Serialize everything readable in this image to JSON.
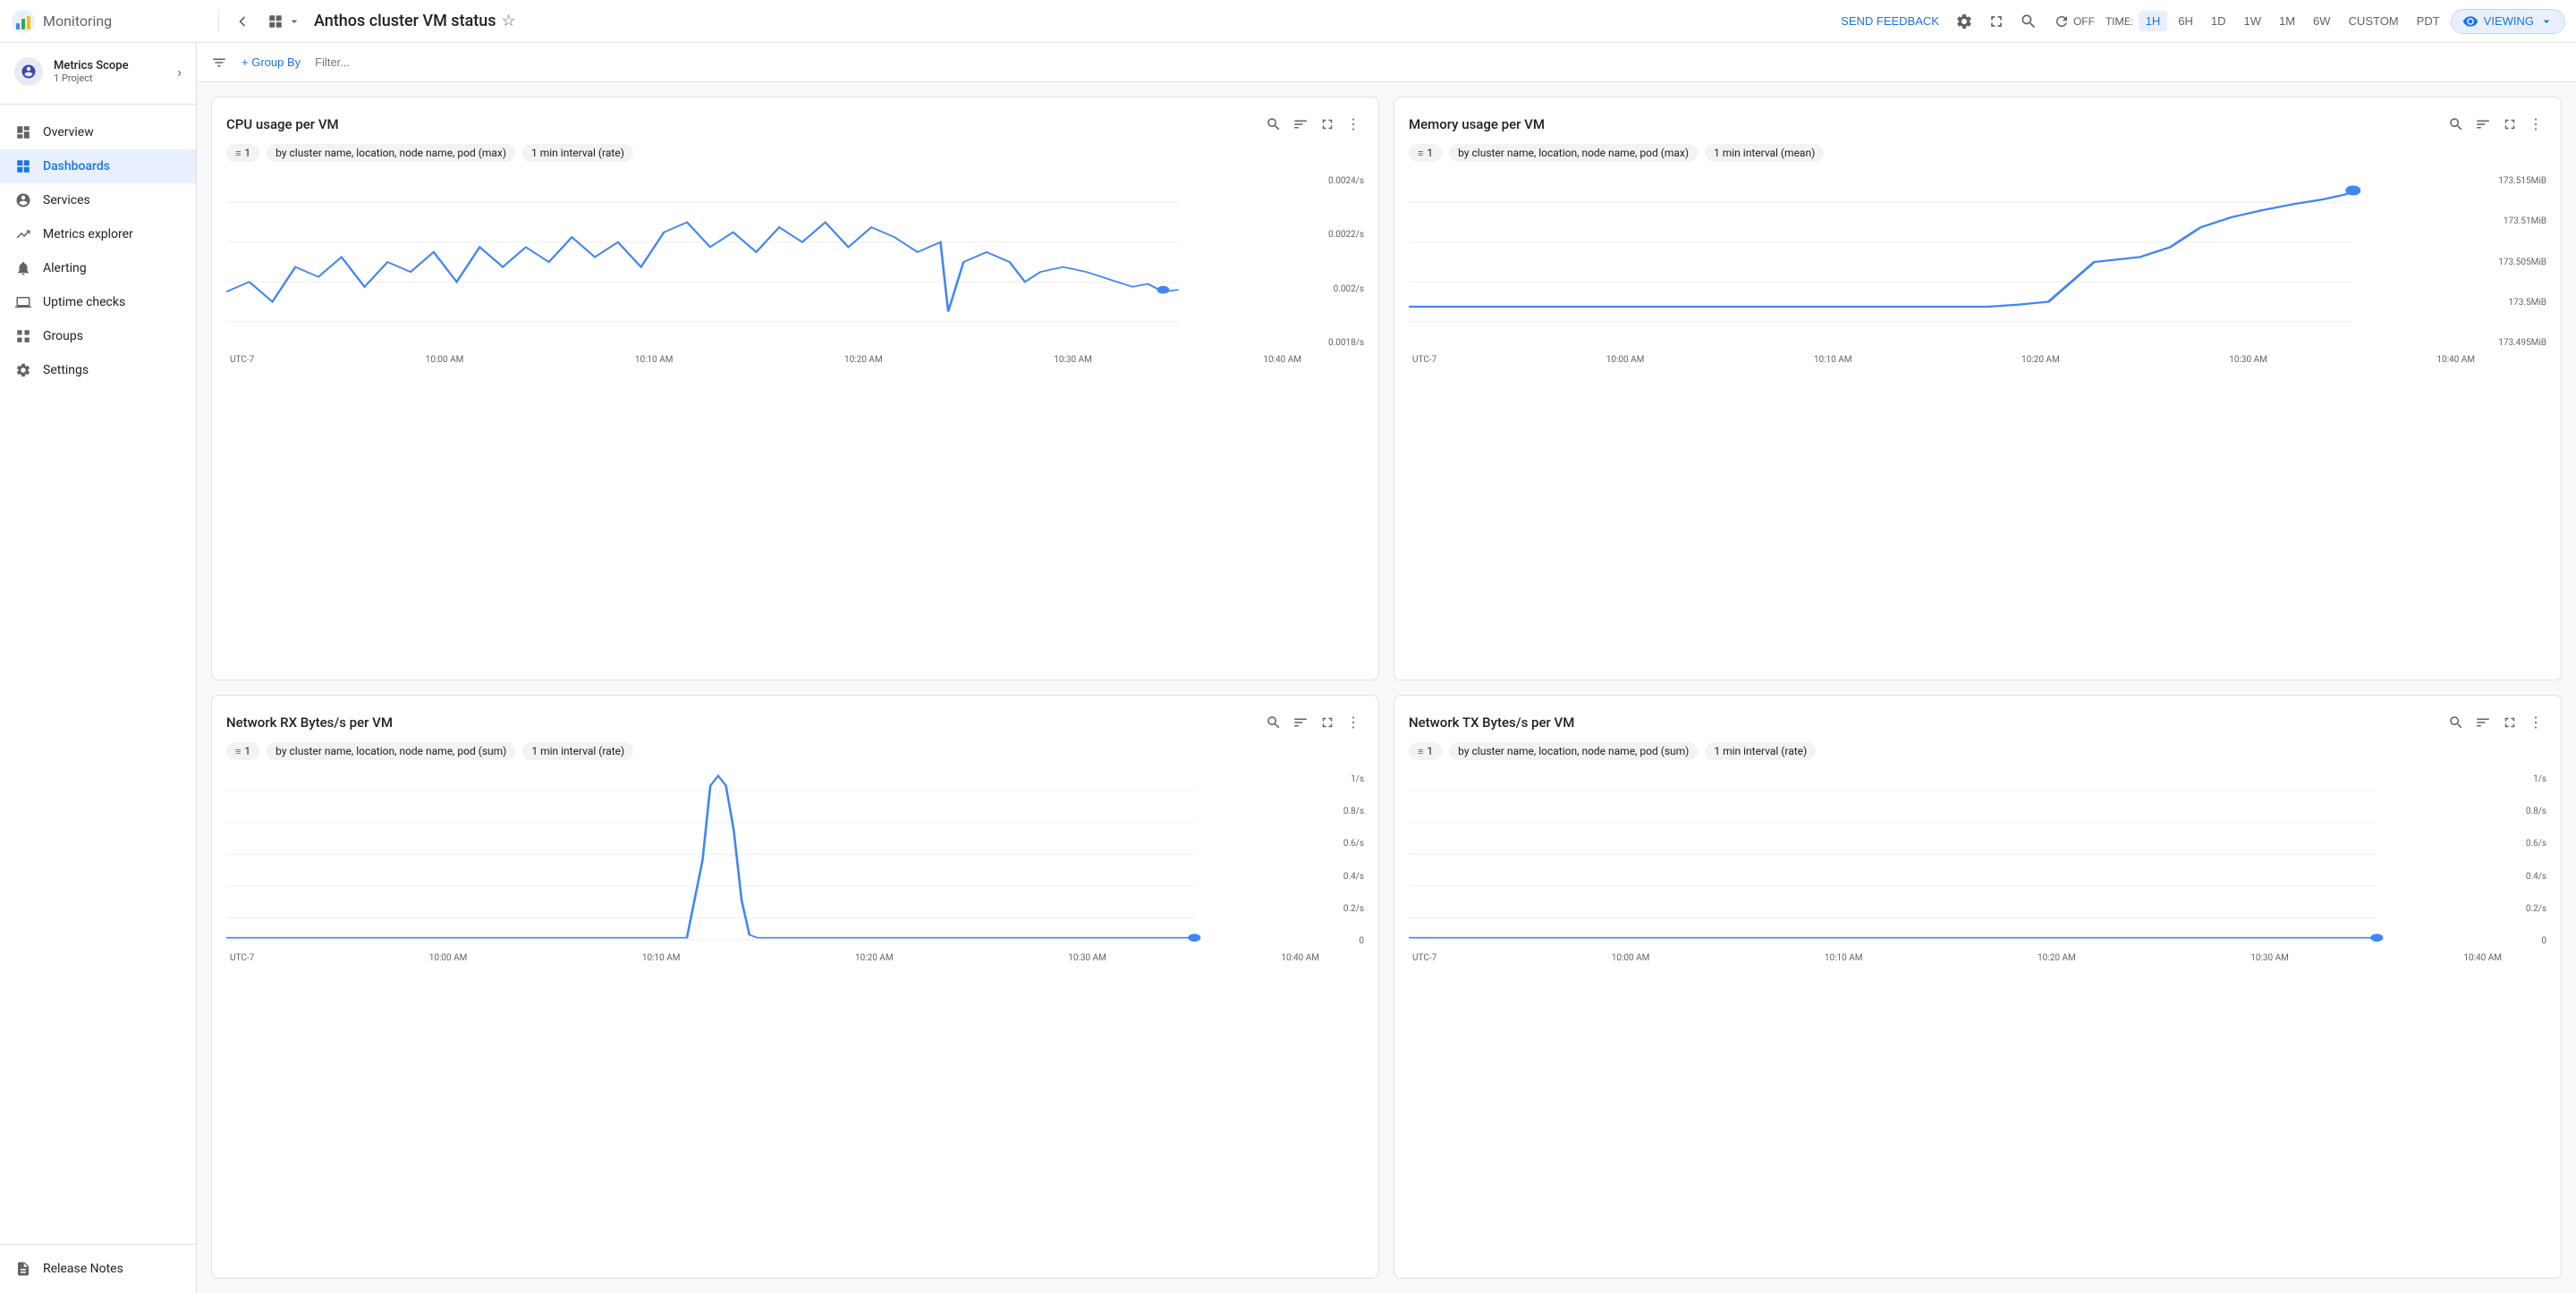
{
  "header": {
    "app_title": "Monitoring",
    "page_title": "Anthos cluster VM status",
    "send_feedback": "SEND FEEDBACK",
    "time_label": "TIME:",
    "time_options": [
      "1H",
      "6H",
      "1D",
      "1W",
      "1M",
      "6W",
      "CUSTOM",
      "PDT"
    ],
    "active_time": "1H",
    "viewing_label": "VIEWING",
    "off_label": "OFF"
  },
  "sidebar": {
    "scope_name": "Metrics Scope",
    "scope_sub": "1 Project",
    "items": [
      {
        "id": "overview",
        "label": "Overview",
        "icon": "📊"
      },
      {
        "id": "dashboards",
        "label": "Dashboards",
        "icon": "⊞",
        "active": true
      },
      {
        "id": "services",
        "label": "Services",
        "icon": "👤"
      },
      {
        "id": "metrics-explorer",
        "label": "Metrics explorer",
        "icon": "📈"
      },
      {
        "id": "alerting",
        "label": "Alerting",
        "icon": "🔔"
      },
      {
        "id": "uptime-checks",
        "label": "Uptime checks",
        "icon": "💻"
      },
      {
        "id": "groups",
        "label": "Groups",
        "icon": "⬜"
      },
      {
        "id": "settings",
        "label": "Settings",
        "icon": "⚙"
      }
    ],
    "bottom_items": [
      {
        "id": "release-notes",
        "label": "Release Notes",
        "icon": "📄"
      }
    ]
  },
  "filter_bar": {
    "group_by_label": "+ Group By",
    "filter_placeholder": "Filter..."
  },
  "charts": [
    {
      "id": "cpu-usage",
      "title": "CPU usage per VM",
      "filter_count": "1",
      "filter_by": "by cluster name, location, node name, pod (max)",
      "interval": "1 min interval (rate)",
      "y_labels": [
        "0.0024/s",
        "0.0022/s",
        "0.002/s",
        "0.0018/s"
      ],
      "x_labels": [
        "UTC-7",
        "10:00 AM",
        "10:10 AM",
        "10:20 AM",
        "10:30 AM",
        "10:40 AM"
      ],
      "chart_type": "cpu"
    },
    {
      "id": "memory-usage",
      "title": "Memory usage per VM",
      "filter_count": "1",
      "filter_by": "by cluster name, location, node name, pod (max)",
      "interval": "1 min interval (mean)",
      "y_labels": [
        "173.515MiB",
        "173.51MiB",
        "173.505MiB",
        "173.5MiB",
        "173.495MiB"
      ],
      "x_labels": [
        "UTC-7",
        "10:00 AM",
        "10:10 AM",
        "10:20 AM",
        "10:30 AM",
        "10:40 AM"
      ],
      "chart_type": "memory"
    },
    {
      "id": "network-rx",
      "title": "Network RX Bytes/s per VM",
      "filter_count": "1",
      "filter_by": "by cluster name, location, node name, pod (sum)",
      "interval": "1 min interval (rate)",
      "y_labels": [
        "1/s",
        "0.8/s",
        "0.6/s",
        "0.4/s",
        "0.2/s",
        "0"
      ],
      "x_labels": [
        "UTC-7",
        "10:00 AM",
        "10:10 AM",
        "10:20 AM",
        "10:30 AM",
        "10:40 AM"
      ],
      "chart_type": "network-rx"
    },
    {
      "id": "network-tx",
      "title": "Network TX Bytes/s per VM",
      "filter_count": "1",
      "filter_by": "by cluster name, location, node name, pod (sum)",
      "interval": "1 min interval (rate)",
      "y_labels": [
        "1/s",
        "0.8/s",
        "0.6/s",
        "0.4/s",
        "0.2/s",
        "0"
      ],
      "x_labels": [
        "UTC-7",
        "10:00 AM",
        "10:10 AM",
        "10:20 AM",
        "10:30 AM",
        "10:40 AM"
      ],
      "chart_type": "network-tx"
    }
  ]
}
